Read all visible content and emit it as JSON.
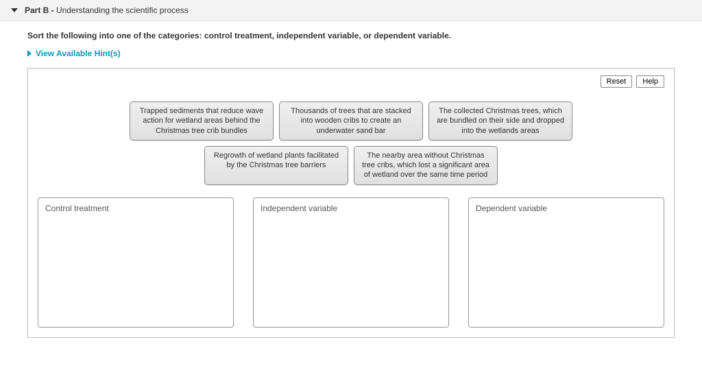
{
  "header": {
    "part_label": "Part B -",
    "part_title": "Understanding the scientific process"
  },
  "instructions": "Sort the following into one of the categories: control treatment, independent variable, or dependent variable.",
  "hints_link": "View Available Hint(s)",
  "toolbar": {
    "reset_label": "Reset",
    "help_label": "Help"
  },
  "items_row1": [
    "Trapped sediments that reduce wave action for wetland areas behind the Christmas tree crib bundles",
    "Thousands of trees that are stacked into wooden cribs to create an underwater sand bar",
    "The collected Christmas trees, which are bundled on their side and dropped into the wetlands areas"
  ],
  "items_row2": [
    "Regrowth of wetland plants facilitated by the Christmas tree barriers",
    "The nearby area without Christmas tree cribs, which lost a significant area of wetland over the same time period"
  ],
  "bins": [
    {
      "title": "Control treatment"
    },
    {
      "title": "Independent variable"
    },
    {
      "title": "Dependent variable"
    }
  ]
}
